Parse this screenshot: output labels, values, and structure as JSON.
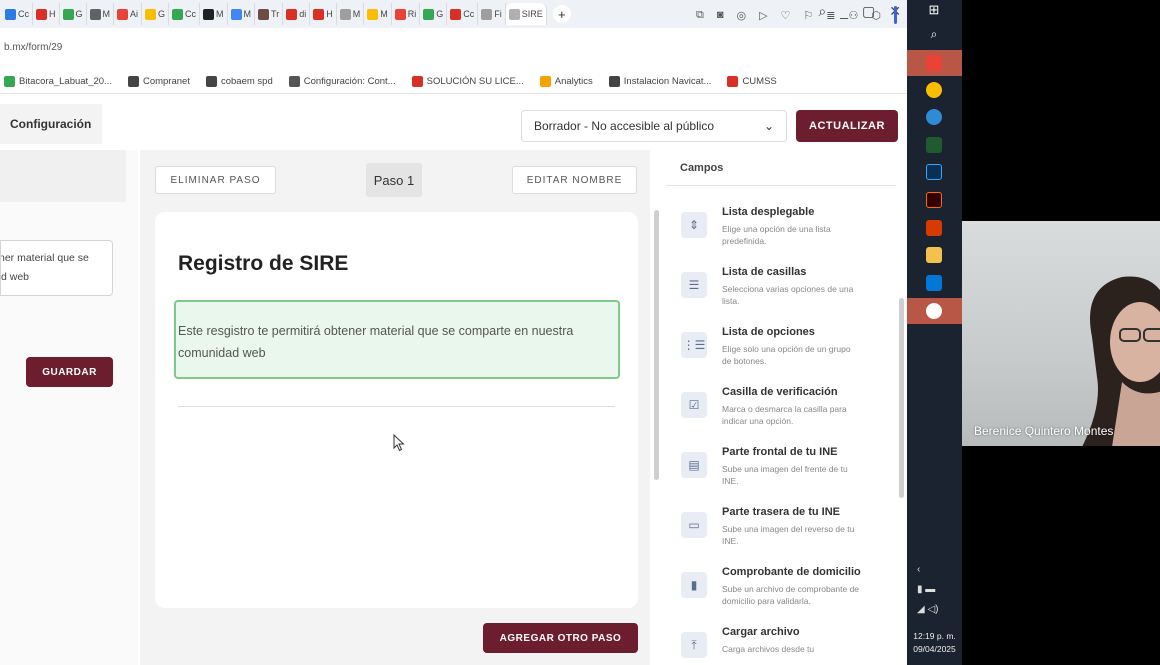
{
  "browser": {
    "tabs": [
      {
        "label": "Cc",
        "color": "#2c7be5"
      },
      {
        "label": "H",
        "color": "#d93025"
      },
      {
        "label": "G",
        "color": "#34a853"
      },
      {
        "label": "M",
        "color": "#5f6368"
      },
      {
        "label": "Ai",
        "color": "#ea4335"
      },
      {
        "label": "G",
        "color": "#fbbc04"
      },
      {
        "label": "Cc",
        "color": "#34a853"
      },
      {
        "label": "M",
        "color": "#202124"
      },
      {
        "label": "M",
        "color": "#4285f4"
      },
      {
        "label": "Tr",
        "color": "#6d4c41"
      },
      {
        "label": "di",
        "color": "#d93025"
      },
      {
        "label": "H",
        "color": "#d93025"
      },
      {
        "label": "M",
        "color": "#9e9e9e"
      },
      {
        "label": "M",
        "color": "#fbbc04"
      },
      {
        "label": "Ri",
        "color": "#ea4335"
      },
      {
        "label": "G",
        "color": "#34a853"
      },
      {
        "label": "Cc",
        "color": "#d93025"
      },
      {
        "label": "Fi",
        "color": "#9e9e9e"
      },
      {
        "label": "SIRE",
        "color": "#b0b0b0",
        "active": true
      }
    ],
    "new_tab": "+",
    "window_controls": [
      "⌕",
      "_",
      "▢",
      "✕"
    ],
    "url": "b.mx/form/29",
    "bookmarks": [
      {
        "label": "Bitacora_Labuat_20...",
        "color": "#34a853"
      },
      {
        "label": "Compranet",
        "color": "#444444"
      },
      {
        "label": "cobaem spd",
        "color": "#444444"
      },
      {
        "label": "Configuración: Cont...",
        "color": "#555555"
      },
      {
        "label": "SOLUCIÓN SU LICE...",
        "color": "#d93025"
      },
      {
        "label": "Analytics",
        "color": "#f4a300"
      },
      {
        "label": "Instalacion Navicat...",
        "color": "#444444"
      },
      {
        "label": "CUMSS",
        "color": "#d93025"
      }
    ]
  },
  "header": {
    "config_tab": "Configuración",
    "status_select": "Borrador - No accesible al público",
    "update_button": "ACTUALIZAR"
  },
  "left_panel": {
    "textarea_line1": "ner material que se",
    "textarea_line2": "d web",
    "save_button": "GUARDAR"
  },
  "step": {
    "delete_button": "ELIMINAR PASO",
    "label": "Paso 1",
    "rename_button": "EDITAR NOMBRE",
    "title": "Registro de SIRE",
    "description": "Este resgistro te permitirá obtener material que se comparte en nuestra comunidad web",
    "add_step_button": "AGREGAR OTRO PASO"
  },
  "fields_panel": {
    "title": "Campos",
    "items": [
      {
        "icon": "dropdown-icon",
        "glyph": "⇕",
        "title": "Lista desplegable",
        "desc": "Elige una opción de una lista predefinida."
      },
      {
        "icon": "checklist-icon",
        "glyph": "☰",
        "title": "Lista de casillas",
        "desc": "Selecciona varias opciones de una lista."
      },
      {
        "icon": "options-list-icon",
        "glyph": "⋮☰",
        "title": "Lista de opciones",
        "desc": "Elige solo una opción de un grupo de botones."
      },
      {
        "icon": "checkbox-icon",
        "glyph": "☑",
        "title": "Casilla de verificación",
        "desc": "Marca o desmarca la casilla para indicar una opción."
      },
      {
        "icon": "id-front-icon",
        "glyph": "▤",
        "title": "Parte frontal de tu INE",
        "desc": "Sube una imagen del frente de tu INE."
      },
      {
        "icon": "id-back-icon",
        "glyph": "▭",
        "title": "Parte trasera de tu INE",
        "desc": "Sube una imagen del reverso de tu INE."
      },
      {
        "icon": "document-icon",
        "glyph": "▮",
        "title": "Comprobante de domicilio",
        "desc": "Sube un archivo de comprobante de domicilio para validarla."
      },
      {
        "icon": "upload-icon",
        "glyph": "⤒",
        "title": "Cargar archivo",
        "desc": "Carga archivos desde tu"
      }
    ]
  },
  "taskbar": {
    "clock_time": "12:19 p. m.",
    "clock_date": "09/04/2025"
  },
  "webcam": {
    "name": "Berenice Quintero Montes"
  }
}
